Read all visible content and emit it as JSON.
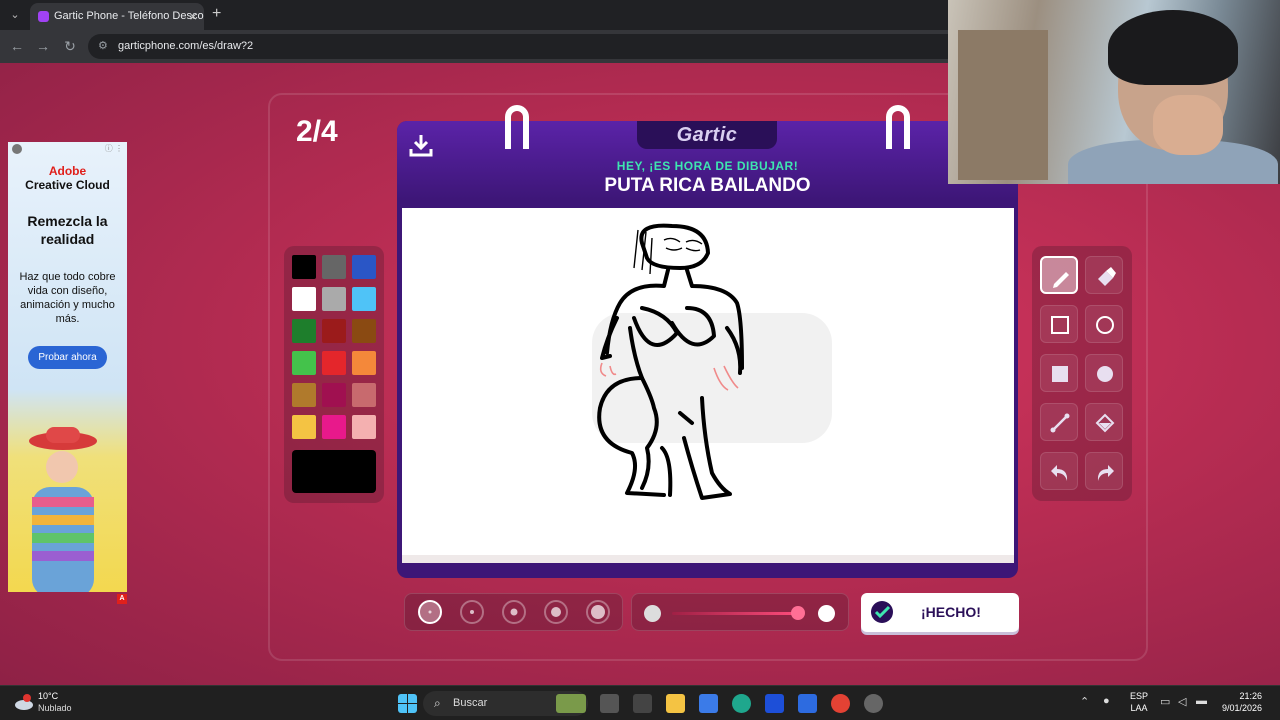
{
  "browser": {
    "tab_title": "Gartic Phone - Teléfono Descon",
    "url": "garticphone.com/es/draw?2"
  },
  "game": {
    "round": "2/4",
    "logo": "Gartic",
    "prompt_label": "HEY, ¡ES HORA DE DIBUJAR!",
    "prompt_text": "PUTA RICA BAILANDO",
    "done_label": "¡HECHO!",
    "selected_color": "#000000",
    "selected_size_index": 0,
    "opacity_percent": 100,
    "palette": [
      "#000000",
      "#666666",
      "#2a56c6",
      "#ffffff",
      "#aaaaaa",
      "#4fc3f7",
      "#1e7e2c",
      "#9b1b1b",
      "#8a4a12",
      "#44c24b",
      "#e4262b",
      "#f4883a",
      "#b07a2c",
      "#a01050",
      "#c86a6e",
      "#f4c343",
      "#e8198b",
      "#f4b0b0"
    ],
    "tools": [
      "pencil-tool",
      "eraser-tool",
      "rectangle-outline-tool",
      "ellipse-outline-tool",
      "rectangle-fill-tool",
      "ellipse-fill-tool",
      "line-tool",
      "fill-bucket-tool",
      "undo-tool",
      "redo-tool"
    ]
  },
  "ad": {
    "brand_line1": "Adobe",
    "brand_line2": "Creative Cloud",
    "headline": "Remezcla la realidad",
    "body": "Haz que todo cobre vida con diseño, animación y mucho más.",
    "cta": "Probar ahora"
  },
  "taskbar": {
    "temperature": "10°C",
    "weather": "Nublado",
    "search_placeholder": "Buscar",
    "lang_line1": "ESP",
    "lang_line2": "LAA",
    "time": "21:26",
    "date": "9/01/2026"
  }
}
